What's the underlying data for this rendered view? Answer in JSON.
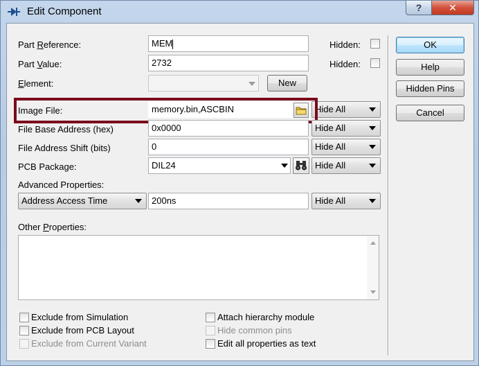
{
  "window": {
    "title": "Edit Component",
    "help_glyph": "?",
    "close_glyph": "✕"
  },
  "fields": {
    "part_reference": {
      "label_pre": "Part ",
      "label_key": "R",
      "label_post": "eference:",
      "value": "MEM",
      "hidden_label": "Hidden:"
    },
    "part_value": {
      "label_pre": "Part ",
      "label_key": "V",
      "label_post": "alue:",
      "value": "2732",
      "hidden_label": "Hidden:"
    },
    "element": {
      "label_pre": "",
      "label_key": "E",
      "label_post": "lement:",
      "value": "",
      "new_label": "New"
    },
    "image_file": {
      "label": "Image File:",
      "value": "memory.bin,ASCBIN",
      "visibility": "Hide All"
    },
    "file_base_address": {
      "label": "File Base Address (hex)",
      "value": "0x0000",
      "visibility": "Hide All"
    },
    "file_address_shift": {
      "label": "File Address Shift (bits)",
      "value": "0",
      "visibility": "Hide All"
    },
    "pcb_package": {
      "label": "PCB Package:",
      "value": "DIL24",
      "visibility": "Hide All"
    },
    "advanced": {
      "label": "Advanced Properties:",
      "property": "Address Access Time",
      "value": "200ns",
      "visibility": "Hide All"
    },
    "other": {
      "label_pre": "Other ",
      "label_key": "P",
      "label_post": "roperties:",
      "value": ""
    }
  },
  "buttons": {
    "ok": "OK",
    "help": "Help",
    "hidden_pins": "Hidden Pins",
    "cancel": "Cancel"
  },
  "checkboxes": {
    "exclude_simulation": "Exclude from Simulation",
    "exclude_pcb": "Exclude from PCB Layout",
    "exclude_variant": "Exclude from Current Variant",
    "attach_hierarchy": "Attach hierarchy module",
    "hide_common_pins": "Hide common pins",
    "edit_all_as_text": "Edit all properties as text"
  },
  "colors": {
    "highlight": "#7a0a1c",
    "default_button": "#3c7fb1"
  },
  "icons": {
    "app": "component-icon",
    "image_browse": "folder-icon",
    "package_browse": "binoculars-icon"
  }
}
